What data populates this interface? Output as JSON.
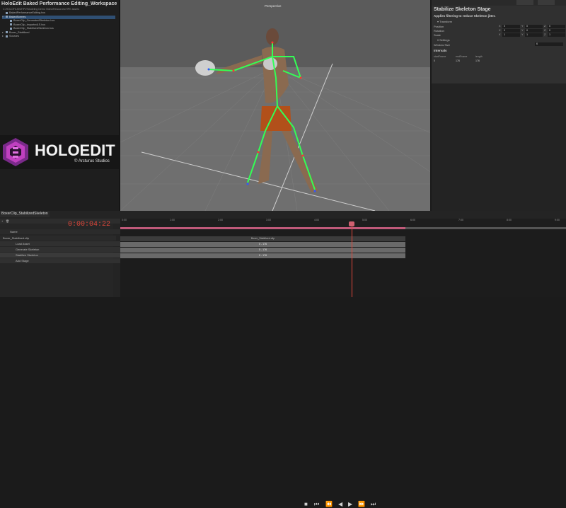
{
  "project": {
    "title": "HoloEdit Baked Performance Editing_Workspace",
    "path": "C:/HOLOFILMS/HPV/Modeling Demo Video/Resources/HPE assets",
    "items": [
      {
        "label": "BakedPerformanceEditing.hcs",
        "indent": 0,
        "selected": false,
        "expand": ""
      },
      {
        "label": "BakedScenes",
        "indent": 0,
        "selected": true,
        "expand": "▾"
      },
      {
        "label": "BoxerClip_GeneratedSkeleton.hcs",
        "indent": 1,
        "selected": false,
        "expand": ""
      },
      {
        "label": "BoxerClip_ImportedLS.hcs",
        "indent": 1,
        "selected": false,
        "expand": ""
      },
      {
        "label": "BoxerClip_StabilizedSkeleton.hcs",
        "indent": 1,
        "selected": false,
        "expand": ""
      },
      {
        "label": "Boxer_Stabilized",
        "indent": 0,
        "selected": false,
        "expand": "▸"
      },
      {
        "label": "Sources",
        "indent": 0,
        "selected": false,
        "expand": "▸"
      }
    ]
  },
  "logo": {
    "brand": "HOLOEDIT",
    "subtitle": "© Arcturus Studios"
  },
  "viewport": {
    "label": "Perspective"
  },
  "inspector": {
    "title": "Stabilize Skeleton Stage",
    "description": "Applies filtering to reduce Skeleton jitter.",
    "transform_header": "Transform",
    "rows": [
      {
        "label": "Position",
        "x": "0",
        "y": "0",
        "z": "0"
      },
      {
        "label": "Rotation",
        "x": "0",
        "y": "0",
        "z": "0"
      },
      {
        "label": "Scale",
        "x": "1",
        "y": "1",
        "z": "1"
      }
    ],
    "settings_header": "Settings",
    "window_size_label": "Window Size",
    "window_size_value": "6",
    "intervals_header": "Intervals",
    "interval_cols": [
      "startFrame",
      "endFrame",
      "length"
    ],
    "interval_rows": [
      [
        "0",
        "176",
        "176"
      ]
    ]
  },
  "timeline": {
    "tab": "BoxerClip_StabilizedSkeleton",
    "timecode": "0:00:04:22",
    "name_header": "Name",
    "tracks": [
      {
        "label": "Boxer_Stabilized.clip",
        "indent": 4
      },
      {
        "label": "Load Asset",
        "indent": 22
      },
      {
        "label": "Generate Skeleton",
        "indent": 22
      },
      {
        "label": "Stabilize Skeleton",
        "indent": 22
      },
      {
        "label": "Add Stage",
        "indent": 22
      }
    ],
    "ticks": [
      "0:00",
      "1:00",
      "2:00",
      "3:00",
      "4:00",
      "5:00",
      "6:00",
      "7:00",
      "8:00",
      "9:00"
    ],
    "clip_title": "Boxer_Stabilized.clip",
    "clips": [
      "0 - 176",
      "0 - 176",
      "0 - 176"
    ],
    "progress": 0.64
  }
}
